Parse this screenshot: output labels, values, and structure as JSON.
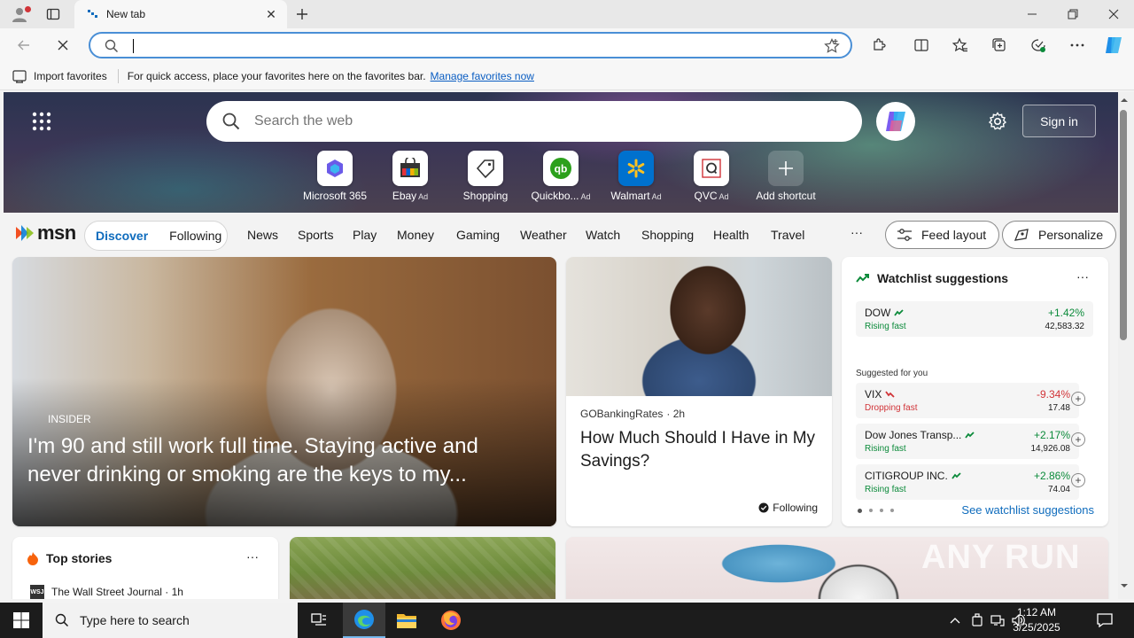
{
  "browser": {
    "tab_title": "New tab",
    "address_value": "",
    "favbar": {
      "import_label": "Import favorites",
      "message": "For quick access, place your favorites here on the favorites bar.",
      "manage_link": "Manage favorites now"
    }
  },
  "hero": {
    "search_placeholder": "Search the web",
    "signin_label": "Sign in",
    "shortcuts": [
      {
        "label": "Microsoft 365",
        "ad": ""
      },
      {
        "label": "Ebay",
        "ad": "Ad"
      },
      {
        "label": "Shopping",
        "ad": ""
      },
      {
        "label": "Quickbo...",
        "ad": "Ad"
      },
      {
        "label": "Walmart",
        "ad": "Ad"
      },
      {
        "label": "QVC",
        "ad": "Ad"
      },
      {
        "label": "Add shortcut",
        "ad": ""
      }
    ]
  },
  "msn": {
    "logo_text": "msn",
    "pills": [
      "Discover",
      "Following"
    ],
    "nav": [
      "News",
      "Sports",
      "Play",
      "Money",
      "Gaming",
      "Weather",
      "Watch",
      "Shopping",
      "Health",
      "Travel"
    ],
    "more_label": "···",
    "feed_layout_label": "Feed layout",
    "personalize_label": "Personalize"
  },
  "hero_card": {
    "source": "INSIDER",
    "title": "I'm 90 and still work full time. Staying active and never drinking or smoking are the keys to my..."
  },
  "article_card": {
    "source": "GOBankingRates",
    "time": "· 2h",
    "title": "How Much Should I Have in My Savings?",
    "follow_label": "Following"
  },
  "watchlist": {
    "title": "Watchlist suggestions",
    "more_label": "···",
    "primary": {
      "name": "DOW",
      "trend": "Rising fast",
      "change": "+1.42%",
      "price": "42,583.32"
    },
    "suggested_label": "Suggested for you",
    "suggested": [
      {
        "name": "VIX",
        "trend": "Dropping fast",
        "change": "-9.34%",
        "price": "17.48"
      },
      {
        "name": "Dow Jones Transp...",
        "trend": "Rising fast",
        "change": "+2.17%",
        "price": "14,926.08"
      },
      {
        "name": "CITIGROUP INC.",
        "trend": "Rising fast",
        "change": "+2.86%",
        "price": "74.04"
      }
    ],
    "see_link": "See watchlist suggestions"
  },
  "top_stories": {
    "title": "Top stories",
    "more_label": "···",
    "source_badge": "WSJ",
    "source": "The Wall Street Journal · 1h"
  },
  "watermark": "ANY RUN",
  "taskbar": {
    "search_placeholder": "Type here to search",
    "time": "1:12 AM",
    "date": "3/25/2025"
  },
  "colors": {
    "accent": "#0f6cbd",
    "rising": "#0b8a3a",
    "dropping": "#d13438"
  }
}
